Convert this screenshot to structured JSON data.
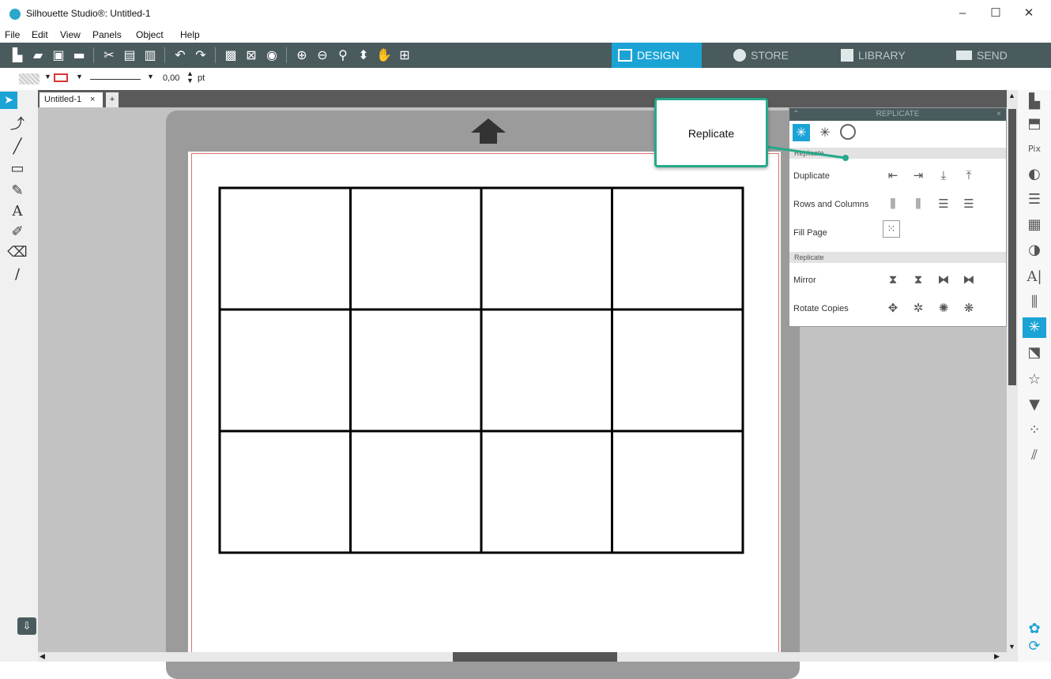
{
  "window": {
    "title": "Silhouette Studio®: Untitled-1",
    "minimize": "–",
    "maximize": "☐",
    "close": "✕"
  },
  "menu": [
    "File",
    "Edit",
    "View",
    "Panels",
    "Object",
    "Help"
  ],
  "tabs": {
    "design": "DESIGN",
    "store": "STORE",
    "library": "LIBRARY",
    "send": "SEND"
  },
  "props": {
    "line_width": "0,00",
    "unit": "pt"
  },
  "document_tab": {
    "label": "Untitled-1",
    "close": "×",
    "add": "+"
  },
  "replicate_panel": {
    "title": "REPLICATE",
    "section_1": "Replicate",
    "section_2": "Replicate",
    "rows": {
      "duplicate": "Duplicate",
      "rows_columns": "Rows and Columns",
      "fill_page": "Fill Page",
      "mirror": "Mirror",
      "rotate_copies": "Rotate Copies"
    }
  },
  "callout": {
    "text": "Replicate"
  },
  "grid": {
    "rows": 3,
    "columns": 4
  },
  "colors": {
    "accent": "#1ba3d6",
    "toolbar": "#4a5b5e",
    "callout_border": "#27a88a"
  }
}
